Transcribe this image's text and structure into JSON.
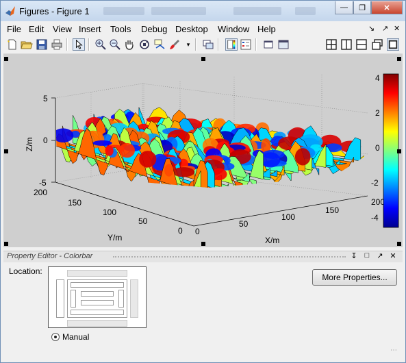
{
  "window": {
    "title": "Figures - Figure 1"
  },
  "menu": [
    "File",
    "Edit",
    "View",
    "Insert",
    "Tools",
    "Debug",
    "Desktop",
    "Window",
    "Help"
  ],
  "toolbar": {
    "icons": [
      "new-file-icon",
      "open-folder-icon",
      "save-icon",
      "print-icon",
      "pointer-icon",
      "zoom-in-icon",
      "zoom-out-icon",
      "pan-icon",
      "rotate-3d-icon",
      "data-cursor-icon",
      "brush-icon",
      "dropdown-arrow-icon",
      "link-plot-icon",
      "colorbar-icon",
      "legend-icon",
      "hide-tools-icon",
      "show-tools-icon",
      "grid-layout-icon",
      "split-columns-icon",
      "split-rows-icon",
      "float-icon",
      "maximize-icon"
    ]
  },
  "plot": {
    "z_axis_label": "Z/m",
    "y_axis_label": "Y/m",
    "x_axis_label": "X/m",
    "z_ticks": [
      "5",
      "0",
      "-5"
    ],
    "y_ticks": [
      "200",
      "150",
      "100",
      "50",
      "0"
    ],
    "x_ticks": [
      "0",
      "50",
      "100",
      "150",
      "200"
    ],
    "colorbar_ticks": [
      "4",
      "2",
      "0",
      "-2",
      "-4"
    ]
  },
  "chart_data": {
    "type": "surface",
    "xlabel": "X/m",
    "ylabel": "Y/m",
    "zlabel": "Z/m",
    "xlim": [
      0,
      200
    ],
    "ylim": [
      0,
      200
    ],
    "zlim": [
      -5,
      5
    ],
    "colorbar_range": [
      -4.5,
      4.5
    ],
    "colormap": "jet"
  },
  "property_editor": {
    "title": "Property Editor - Colorbar",
    "location_label": "Location:",
    "manual_label": "Manual",
    "more_properties_label": "More Properties..."
  }
}
